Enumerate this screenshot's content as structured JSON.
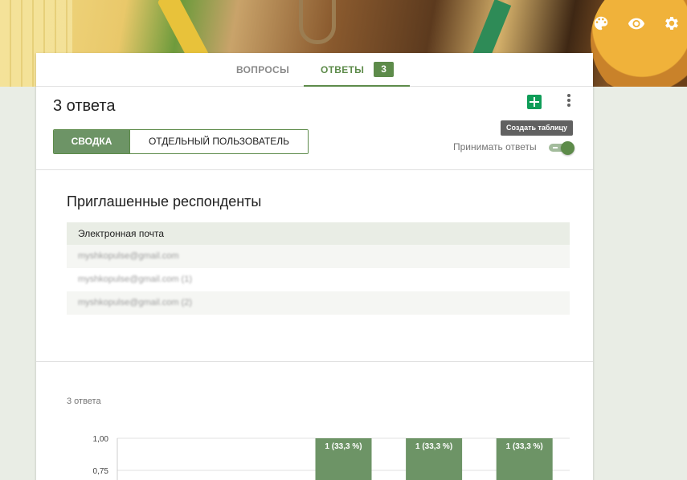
{
  "header_icons": [
    {
      "name": "palette-icon"
    },
    {
      "name": "eye-icon"
    },
    {
      "name": "gear-icon"
    }
  ],
  "tabs": {
    "questions": "ВОПРОСЫ",
    "responses": "ОТВЕТЫ",
    "responses_count": "3"
  },
  "responses": {
    "title": "3 ответа",
    "tooltip": "Создать таблицу",
    "summary_button": "СВОДКА",
    "individual_button": "ОТДЕЛЬНЫЙ ПОЛЬЗОВАТЕЛЬ",
    "accept_label": "Принимать ответы",
    "accepting": true
  },
  "invited": {
    "title": "Приглашенные респонденты",
    "column": "Электронная почта",
    "rows": [
      "myshkopulse@gmail.com",
      "myshkopulse@gmail.com (1)",
      "myshkopulse@gmail.com (2)"
    ]
  },
  "question": {
    "count_label": "3 ответа"
  },
  "chart_data": {
    "type": "bar",
    "categories": [
      "",
      "",
      "",
      "",
      ""
    ],
    "values": [
      0,
      0,
      1,
      1,
      1
    ],
    "data_labels": [
      "",
      "",
      "1 (33,3 %)",
      "1 (33,3 %)",
      "1 (33,3 %)"
    ],
    "y_ticks": [
      "1,00",
      "0,75"
    ],
    "ylim": [
      0,
      1
    ],
    "bar_color": "#6d9466"
  },
  "colors": {
    "accent": "#5d8b4a",
    "background": "#e9ede5"
  }
}
